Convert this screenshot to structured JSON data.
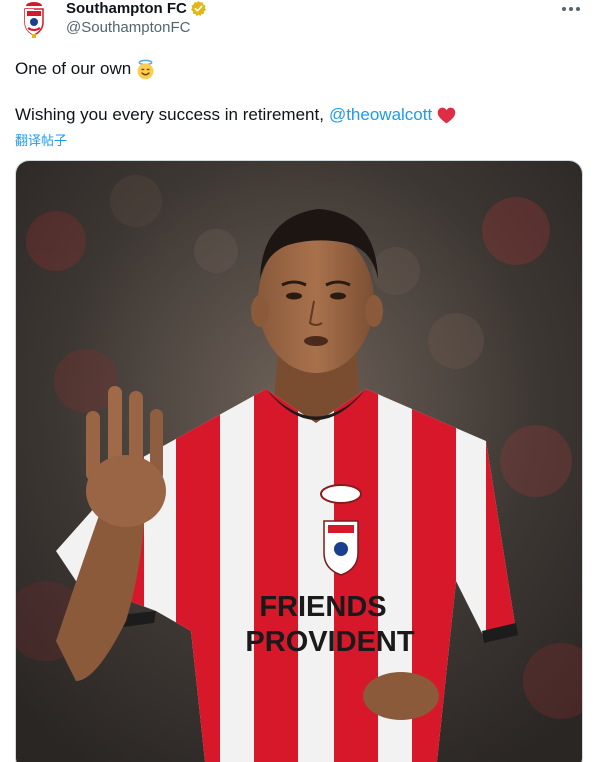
{
  "header": {
    "display_name": "Southampton FC",
    "handle": "@SouthamptonFC",
    "avatar_icon": "club-crest-icon",
    "verified_icon": "verified-badge-icon",
    "more_icon": "more-horizontal-icon"
  },
  "tweet": {
    "line1_text": "One of our own",
    "line1_emoji": "smiling-face-with-halo",
    "line2_text": "Wishing you every success in retirement,",
    "mention": "@theowalcott",
    "line2_emoji": "red-heart",
    "translate_label": "翻译帖子"
  },
  "media": {
    "description_icon": "player-photo",
    "shirt_sponsor_line1": "FRIENDS",
    "shirt_sponsor_line2": "PROVIDENT"
  },
  "colors": {
    "link": "#1d9bf0",
    "verified": "#e2b719",
    "shirt_red": "#d7182a",
    "text_primary": "#0f1419",
    "text_secondary": "#536471"
  }
}
